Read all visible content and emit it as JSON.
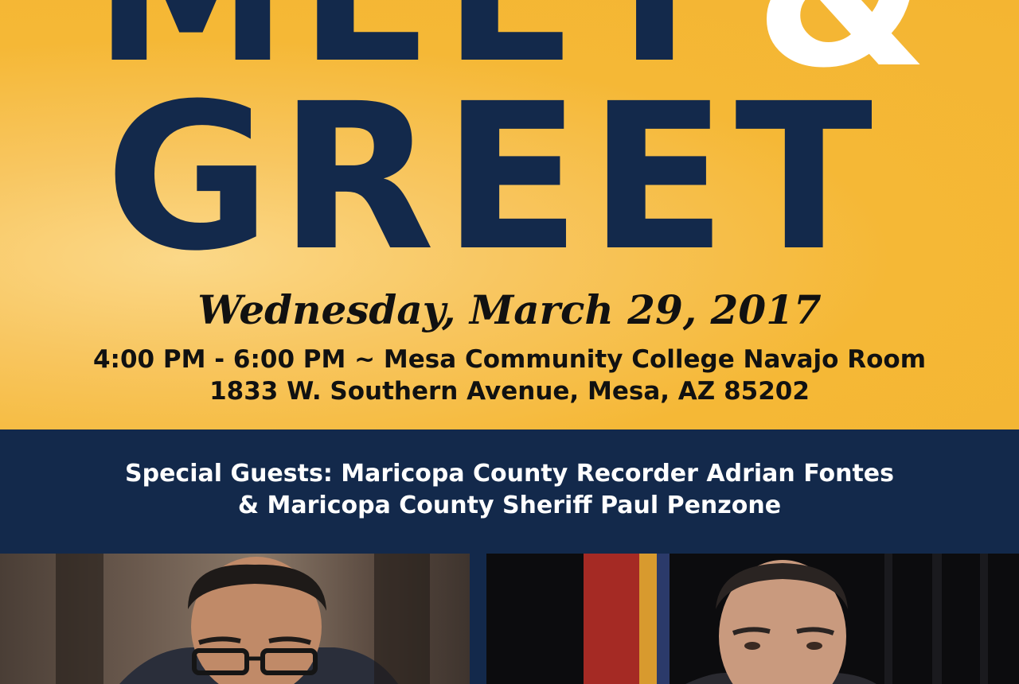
{
  "headline": {
    "line1": "MEET",
    "ampersand": "&",
    "line2": "GREET"
  },
  "event": {
    "date": "Wednesday, March 29, 2017",
    "time_location": "4:00 PM - 6:00 PM ~ Mesa Community College Navajo Room",
    "address": "1833 W. Southern Avenue, Mesa, AZ 85202"
  },
  "guests": {
    "line1": "Special Guests: Maricopa County Recorder Adrian Fontes",
    "line2": "& Maricopa County Sheriff Paul Penzone"
  },
  "colors": {
    "navy": "#13294b",
    "gold": "#f5b836",
    "white": "#ffffff"
  }
}
